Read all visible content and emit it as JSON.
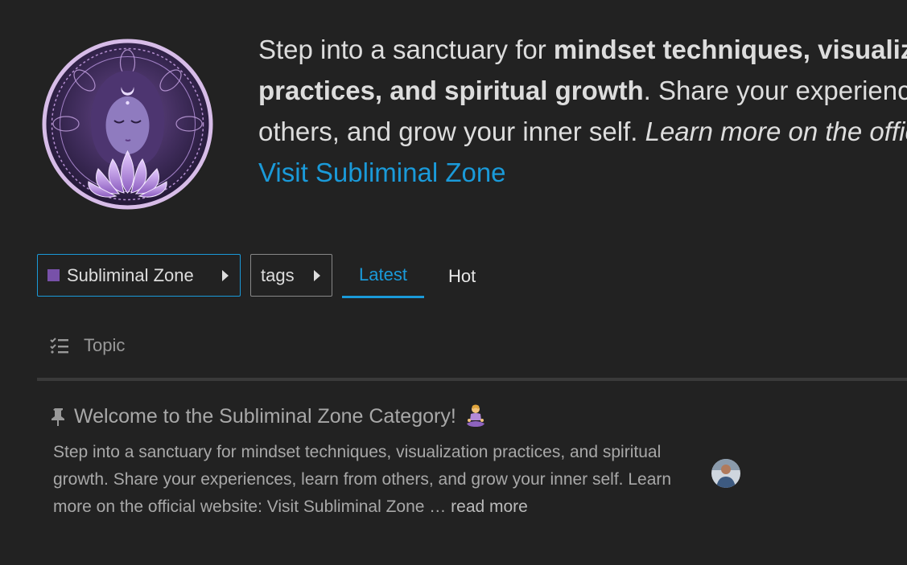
{
  "category": {
    "logo_icon": "meditating-goddess-lotus-logo",
    "description": {
      "part1": "Step into a sanctuary for ",
      "bold1": "mindset techniques, visualization",
      "bold2": "practices, and spiritual growth",
      "part2": ". Share your experiences, learn from",
      "part3": "others, and grow your inner self. ",
      "italic": "Learn more on the official website:",
      "link_label": "Visit Subliminal Zone"
    }
  },
  "navigation": {
    "category_crumb": "Subliminal Zone",
    "category_color": "#7851a9",
    "tags_crumb": "tags",
    "tabs": [
      {
        "label": "Latest",
        "active": true
      },
      {
        "label": "Hot",
        "active": false
      }
    ]
  },
  "topic_list": {
    "header_icon": "checklist-icon",
    "header_label": "Topic",
    "topics": [
      {
        "pinned": true,
        "pin_icon": "pin-icon",
        "title": "Welcome to the Subliminal Zone Category!",
        "title_emoji": "person-in-lotus-position-emoji",
        "excerpt": "Step into a sanctuary for mindset techniques, visualization practices, and spiritual growth. Share your experiences, learn from others, and grow your inner self. Learn more on the official website: Visit Subliminal Zone …",
        "read_more": "read more",
        "poster_avatar": "user-avatar"
      }
    ]
  },
  "colors": {
    "background": "#222222",
    "link": "#1a9ad9",
    "accent": "#7851a9"
  }
}
